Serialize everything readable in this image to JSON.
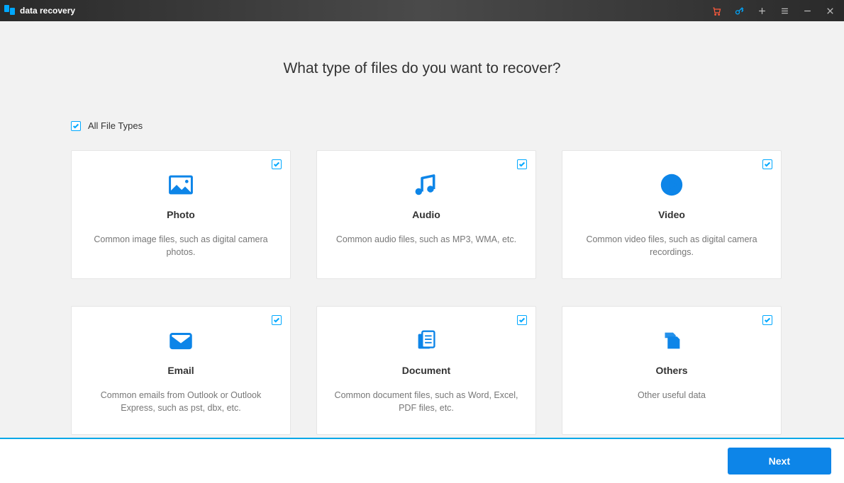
{
  "titlebar": {
    "title": "data recovery"
  },
  "heading": "What type of files do you want to recover?",
  "all_types_label": "All File Types",
  "cards": [
    {
      "title": "Photo",
      "desc": "Common image files, such as digital camera photos."
    },
    {
      "title": "Audio",
      "desc": "Common audio files, such as MP3, WMA, etc."
    },
    {
      "title": "Video",
      "desc": "Common video files, such as digital camera recordings."
    },
    {
      "title": "Email",
      "desc": "Common emails from Outlook or Outlook Express, such as pst, dbx, etc."
    },
    {
      "title": "Document",
      "desc": "Common document files, such as Word, Excel, PDF files, etc."
    },
    {
      "title": "Others",
      "desc": "Other useful data"
    }
  ],
  "footer": {
    "next_label": "Next"
  }
}
